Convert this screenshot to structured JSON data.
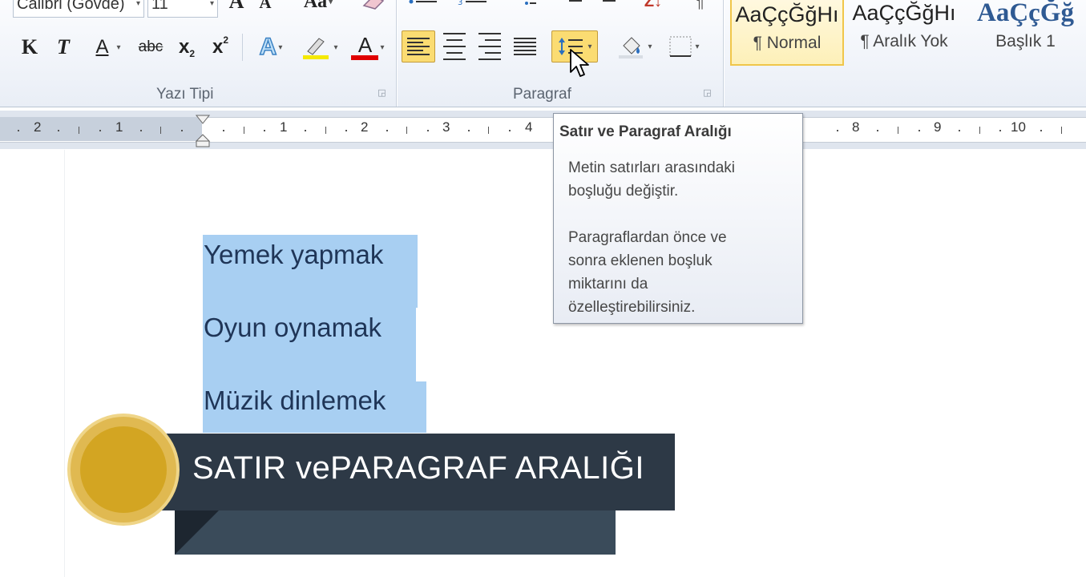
{
  "ribbon": {
    "font_name": "Calibri (Gövde)",
    "font_size": "11",
    "font_group_label": "Yazı Tipi",
    "paragraph_group_label": "Paragraf",
    "bold_glyph": "K",
    "italic_glyph": "T",
    "underline_glyph": "A",
    "strikethrough_glyph": "abc",
    "subscript_glyph": "x",
    "subscript_mark": "2",
    "superscript_glyph": "x",
    "superscript_mark": "2",
    "text_effects_glyph": "A",
    "font_color_glyph": "A",
    "grow_font_glyph": "A",
    "shrink_font_glyph": "A",
    "change_case_glyph": "Aa",
    "sort_glyph": "Z↓",
    "pilcrow_glyph": "¶",
    "styles": [
      {
        "preview": "AaÇçĞğHı",
        "label": "¶ Normal"
      },
      {
        "preview": "AaÇçĞğHı",
        "label": "¶ Aralık Yok"
      },
      {
        "preview": "AaÇçĞğ",
        "label": "Başlık 1"
      }
    ]
  },
  "ruler": {
    "labels": [
      "2",
      "1",
      "1",
      "2",
      "3",
      "4",
      "8",
      "9",
      "10"
    ]
  },
  "document": {
    "lines": [
      "Yemek yapmak",
      "Oyun oynamak",
      "Müzik dinlemek"
    ]
  },
  "tooltip": {
    "title": "Satır ve Paragraf Aralığı",
    "line1": "Metin satırları arasındaki",
    "line2": "boşluğu değiştir.",
    "line3": "Paragraflardan önce ve",
    "line4": "sonra eklenen boşluk",
    "line5": "miktarını da",
    "line6": "özelleştirebilirsiniz."
  },
  "banner": {
    "text": "SATIR vePARAGRAF ARALIĞI"
  },
  "colors": {
    "selection": "#a8cff2",
    "banner_dark": "#2d3946",
    "circle_gold": "#d3a522",
    "font_color_bar": "#e00000",
    "highlight_bar": "#f5e900",
    "active_button": "#fbdc72"
  }
}
